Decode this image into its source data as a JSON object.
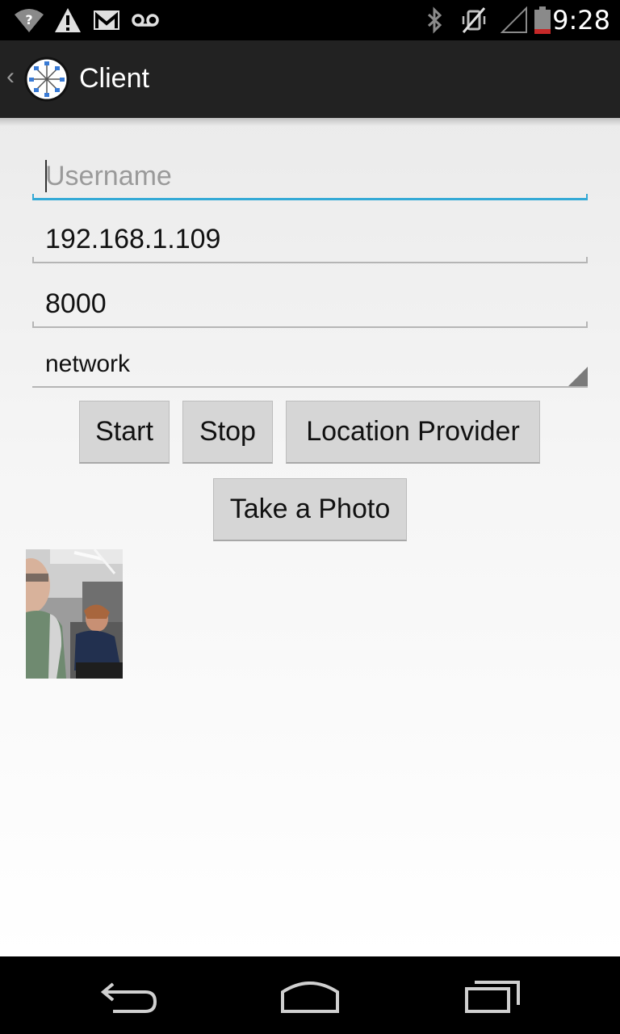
{
  "status_bar": {
    "time": "9:28",
    "left_icons": [
      "wifi-question-icon",
      "warning-icon",
      "gmail-icon",
      "voicemail-icon"
    ],
    "right_icons": [
      "bluetooth-icon",
      "vibrate-icon",
      "signal-icon",
      "battery-icon"
    ]
  },
  "action_bar": {
    "title": "Client",
    "up_icon": "back-caret-icon",
    "app_icon": "network-hub-icon"
  },
  "form": {
    "username_placeholder": "Username",
    "username_value": "",
    "ip_value": "192.168.1.109",
    "port_value": "8000",
    "provider_selected": "network"
  },
  "buttons": {
    "start": "Start",
    "stop": "Stop",
    "location_provider": "Location Provider",
    "take_photo": "Take a Photo"
  },
  "nav_bar": {
    "icons": [
      "back-icon",
      "home-icon",
      "recents-icon"
    ]
  },
  "colors": {
    "accent": "#33a9d6",
    "action_bar": "#222222",
    "button": "#d6d6d6"
  }
}
